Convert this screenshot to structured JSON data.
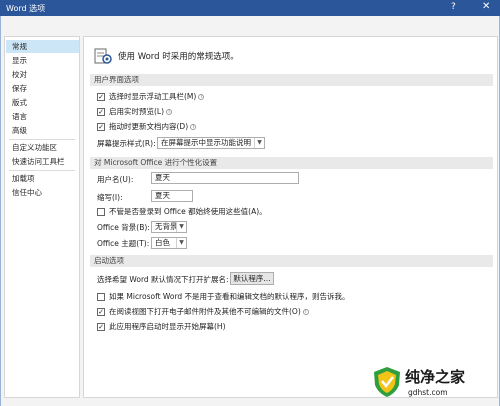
{
  "window": {
    "title": "Word 选项",
    "help": "?",
    "close": "✕"
  },
  "sidebar": {
    "items": [
      {
        "label": "常规"
      },
      {
        "label": "显示"
      },
      {
        "label": "校对"
      },
      {
        "label": "保存"
      },
      {
        "label": "版式"
      },
      {
        "label": "语言"
      },
      {
        "label": "高级"
      },
      {
        "label": "自定义功能区"
      },
      {
        "label": "快速访问工具栏"
      },
      {
        "label": "加载项"
      },
      {
        "label": "信任中心"
      }
    ],
    "active_index": 0
  },
  "header": {
    "text": "使用 Word 时采用的常规选项。"
  },
  "ui_options": {
    "title": "用户界面选项",
    "mini_toolbar": {
      "label": "选择时显示浮动工具栏(M)",
      "checked": true
    },
    "live_preview": {
      "label": "启用实时预览(L)",
      "checked": true
    },
    "update_drag": {
      "label": "拖动时更新文档内容(D)",
      "checked": true
    },
    "screentip_label": "屏幕提示样式(R):",
    "screentip_value": "在屏幕提示中显示功能说明"
  },
  "personalize": {
    "title": "对 Microsoft Office 进行个性化设置",
    "username_label": "用户名(U):",
    "username_value": "夏天",
    "initials_label": "缩写(I):",
    "initials_value": "夏天",
    "always_use": {
      "label": "不管是否登录到 Office 都始终使用这些值(A)。",
      "checked": false
    },
    "background_label": "Office 背景(B):",
    "background_value": "无背景",
    "theme_label": "Office 主题(T):",
    "theme_value": "白色"
  },
  "startup": {
    "title": "启动选项",
    "ext_label": "选择希望 Word 默认情况下打开扩展名:",
    "default_programs_button": "默认程序...",
    "notify_default": {
      "label": "如果 Microsoft Word 不是用于查看和编辑文档的默认程序，则告诉我。",
      "checked": false
    },
    "reading_view": {
      "label": "在阅读视图下打开电子邮件附件及其他不可编辑的文件(O)",
      "checked": true
    },
    "start_screen": {
      "label": "此应用程序启动时显示开始屏幕(H)",
      "checked": true
    }
  },
  "watermark": {
    "brand": "纯净之家",
    "domain": "gdhst.com"
  },
  "colors": {
    "titlebar": "#2b579a",
    "active_item": "#cde6f7",
    "section": "#e9e9e9"
  },
  "icons": [
    "options-general-icon",
    "info-icon",
    "chevron-down-icon",
    "shield-icon"
  ]
}
